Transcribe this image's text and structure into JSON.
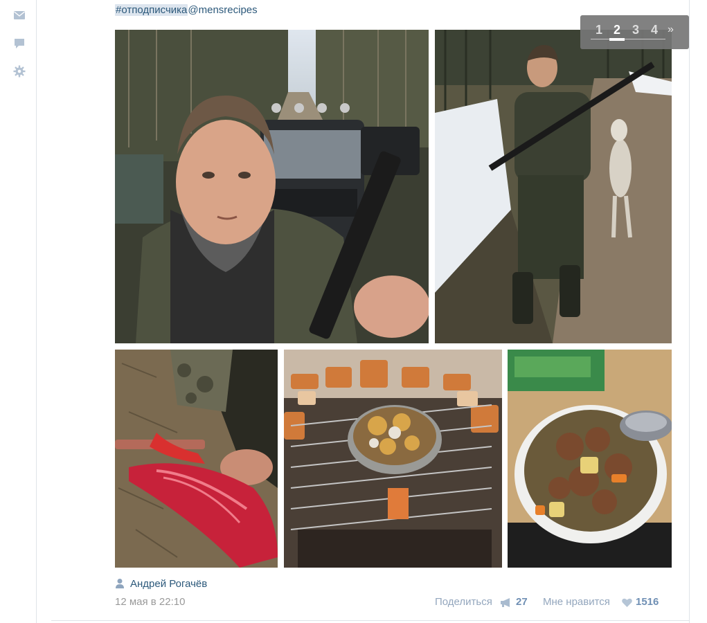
{
  "post": {
    "hashtag": "#отподписчика",
    "mention": "@mensrecipes",
    "author": "Андрей Рогачёв",
    "date": "12 мая в 22:10"
  },
  "pager": {
    "pages": [
      "1",
      "2",
      "3",
      "4"
    ],
    "current": "2",
    "next": "»"
  },
  "actions": {
    "share_label": "Поделиться",
    "share_count": "27",
    "like_label": "Мне нравится",
    "like_count": "1516"
  },
  "sidebar": {
    "icons": [
      "mail-icon",
      "comment-icon",
      "gear-icon"
    ]
  },
  "photos": [
    {
      "subject": "selfie-with-shotgun-and-car"
    },
    {
      "subject": "hunter-holding-hare-on-road"
    },
    {
      "subject": "skinning-hare-with-knife"
    },
    {
      "subject": "pot-on-grill-over-campfire"
    },
    {
      "subject": "bowl-of-stew"
    }
  ],
  "colors": {
    "link": "#2b587a",
    "muted": "#999999",
    "action": "#93a6bd",
    "count": "#6f8fb4",
    "hashtag_bg": "#dde5ee",
    "border": "#dfe3e8"
  }
}
